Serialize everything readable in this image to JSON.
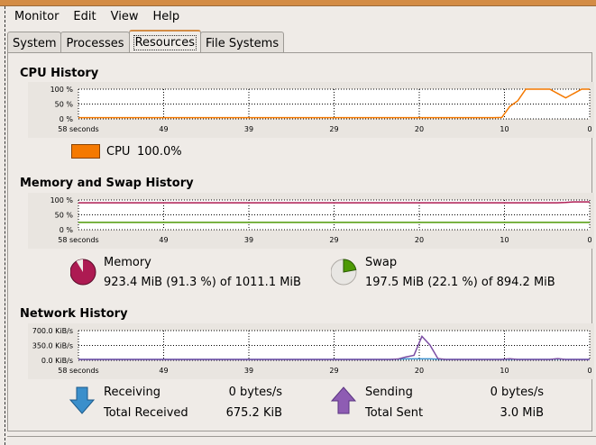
{
  "window": {
    "title": "System Monitor"
  },
  "menu": [
    "Monitor",
    "Edit",
    "View",
    "Help"
  ],
  "tabs": [
    {
      "label": "System"
    },
    {
      "label": "Processes"
    },
    {
      "label": "Resources",
      "active": true
    },
    {
      "label": "File Systems"
    }
  ],
  "time_labels": [
    "58 seconds",
    "49",
    "39",
    "29",
    "20",
    "10",
    "0"
  ],
  "cpu": {
    "title": "CPU History",
    "y_labels": [
      "100 %",
      "50 %",
      "0 %"
    ],
    "legend_label": "CPU",
    "legend_value": "100.0%",
    "color": "#f57900",
    "series": [
      1,
      1,
      1,
      1,
      1,
      1,
      1,
      1,
      1,
      1,
      1,
      1,
      1,
      1,
      1,
      1,
      1,
      1,
      1,
      1,
      1,
      1,
      1,
      1,
      1,
      1,
      1,
      1,
      1,
      1,
      1,
      1,
      1,
      1,
      1,
      1,
      1,
      1,
      1,
      1,
      1,
      1,
      1,
      1,
      1,
      1,
      1,
      1,
      1,
      1,
      1,
      1,
      1,
      2,
      40,
      60,
      100,
      100,
      100,
      100,
      85,
      70,
      85,
      100,
      100
    ]
  },
  "memory": {
    "title": "Memory and Swap History",
    "y_labels": [
      "100 %",
      "50 %",
      "0 %"
    ],
    "mem_label": "Memory",
    "mem_value": "923.4 MiB (91.3 %) of 1011.1 MiB",
    "mem_color": "#ad1a52",
    "mem_percent": 91.3,
    "swap_label": "Swap",
    "swap_value": "197.5 MiB (22.1 %) of 894.2 MiB",
    "swap_color": "#4e9a06",
    "swap_percent": 22.1
  },
  "network": {
    "title": "Network History",
    "y_labels": [
      "700.0 KiB/s",
      "350.0 KiB/s",
      "0.0 KiB/s"
    ],
    "ymax": 700,
    "receiving_label": "Receiving",
    "receiving_value": "0 bytes/s",
    "total_received_label": "Total Received",
    "total_received_value": "675.2 KiB",
    "sending_label": "Sending",
    "sending_value": "0 bytes/s",
    "total_sent_label": "Total Sent",
    "total_sent_value": "3.0 MiB",
    "recv_color": "#3b8fcb",
    "send_color": "#7b4ea3",
    "send_series": [
      0,
      0,
      0,
      0,
      0,
      0,
      0,
      0,
      0,
      0,
      0,
      0,
      0,
      0,
      0,
      0,
      0,
      0,
      0,
      0,
      0,
      0,
      0,
      0,
      0,
      0,
      0,
      0,
      0,
      0,
      0,
      0,
      0,
      0,
      0,
      0,
      0,
      0,
      0,
      0,
      10,
      60,
      100,
      560,
      350,
      20,
      0,
      0,
      0,
      0,
      0,
      0,
      0,
      0,
      15,
      0,
      0,
      0,
      0,
      0,
      20,
      0,
      0,
      0,
      0
    ],
    "recv_series": [
      0,
      0,
      0,
      0,
      0,
      0,
      0,
      0,
      0,
      0,
      0,
      0,
      0,
      0,
      0,
      0,
      0,
      0,
      0,
      0,
      0,
      0,
      0,
      0,
      0,
      0,
      0,
      0,
      0,
      0,
      0,
      0,
      0,
      0,
      0,
      0,
      0,
      0,
      0,
      0,
      5,
      15,
      15,
      15,
      15,
      5,
      0,
      0,
      0,
      0,
      0,
      0,
      0,
      0,
      5,
      0,
      0,
      0,
      0,
      0,
      10,
      0,
      0,
      0,
      0
    ]
  }
}
